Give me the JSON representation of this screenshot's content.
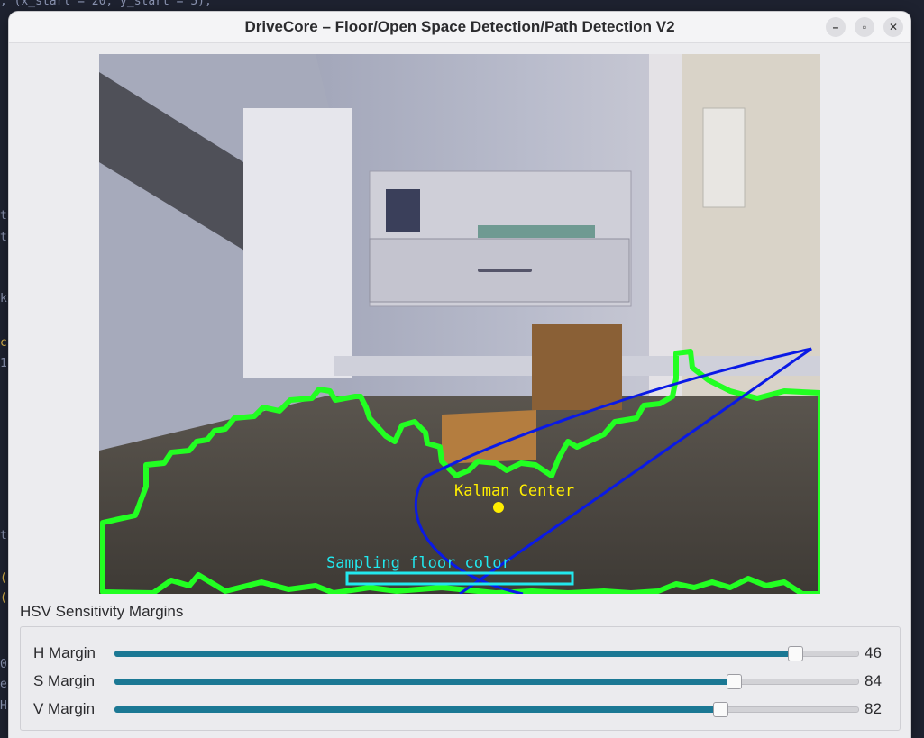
{
  "window": {
    "title": "DriveCore – Floor/Open Space Detection/Path Detection V2"
  },
  "background_code": {
    "lines": [
      ", (x_start = 20, y_start = 5),",
      "t,",
      "t,",
      "k",
      "c",
      "1",
      "t",
      "(",
      "(",
      "0",
      "er",
      "HE"
    ]
  },
  "camera": {
    "overlay_labels": {
      "kalman": "Kalman Center",
      "sampling": "Sampling floor color"
    },
    "colors": {
      "contour": "#22ff22",
      "path": "#0a1ae6",
      "kalman": "#ffee00",
      "sampling": "#22e8ee"
    }
  },
  "hsv": {
    "title": "HSV Sensitivity Margins",
    "sliders": [
      {
        "label": "H Margin",
        "value": "46",
        "fraction": 0.915
      },
      {
        "label": "S Margin",
        "value": "84",
        "fraction": 0.833
      },
      {
        "label": "V Margin",
        "value": "82",
        "fraction": 0.814
      }
    ],
    "accent": "#1b7894"
  }
}
